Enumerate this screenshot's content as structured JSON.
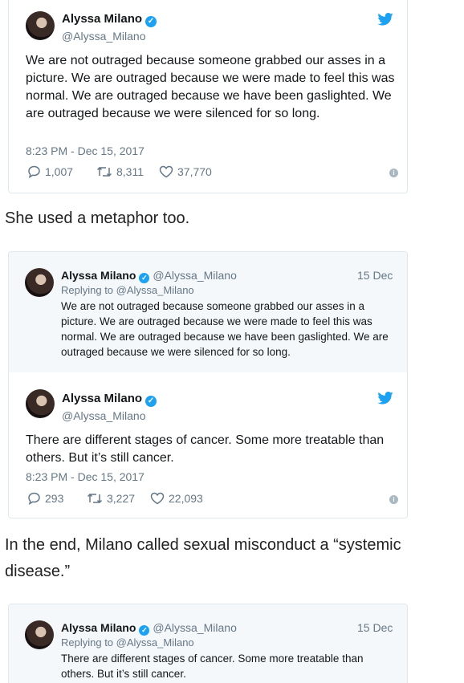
{
  "colors": {
    "twitter_blue": "#1da1f2",
    "muted": "#657786"
  },
  "tweet1": {
    "name": "Alyssa Milano",
    "handle": "@Alyssa_Milano",
    "text": "We are not outraged because someone grabbed our asses in a picture. We are outraged because we were made to feel this was normal. We are outraged because we have been gaslighted. We are outraged because we were silenced for so long.",
    "timestamp": "8:23 PM - Dec 15, 2017",
    "replies": "1,007",
    "retweets": "8,311",
    "likes": "37,770"
  },
  "prose1": "She used a metaphor too.",
  "quote1": {
    "name": "Alyssa Milano",
    "handle": "@Alyssa_Milano",
    "date": "15 Dec",
    "replying_to": "Replying to @Alyssa_Milano",
    "text": "We are not outraged because someone grabbed our asses in a picture. We are outraged because we were made to feel this was normal. We are outraged because we have been gaslighted. We are outraged because we were silenced for so long."
  },
  "tweet2": {
    "name": "Alyssa Milano",
    "handle": "@Alyssa_Milano",
    "text": "There are different stages of cancer. Some more treatable than others. But it’s still cancer.",
    "timestamp": "8:23 PM - Dec 15, 2017",
    "replies": "293",
    "retweets": "3,227",
    "likes": "22,093"
  },
  "prose2": "In the end, Milano called sexual misconduct a “systemic disease.”",
  "quote2": {
    "name": "Alyssa Milano",
    "handle": "@Alyssa_Milano",
    "date": "15 Dec",
    "replying_to": "Replying to @Alyssa_Milano",
    "text": "There are different stages of cancer. Some more treatable than others. But it’s still cancer."
  }
}
